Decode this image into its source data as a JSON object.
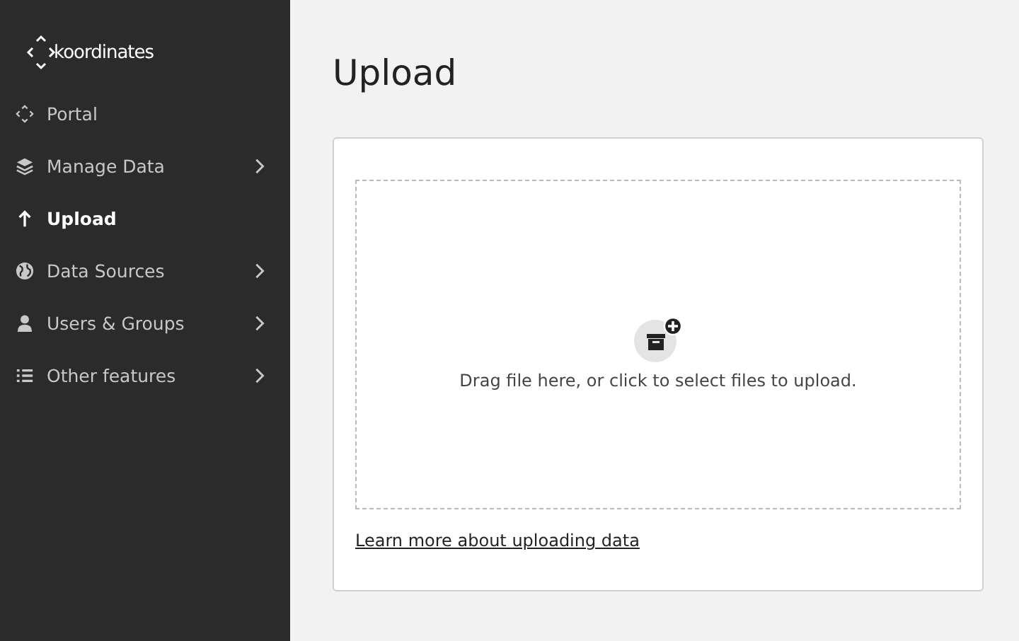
{
  "sidebar": {
    "logo_text": "koordinates",
    "items": [
      {
        "label": "Portal",
        "kind": "portal",
        "selected": false,
        "has_submenu": false
      },
      {
        "label": "Manage Data",
        "kind": "layers",
        "selected": false,
        "has_submenu": true
      },
      {
        "label": "Upload",
        "kind": "upload",
        "selected": true,
        "has_submenu": false
      },
      {
        "label": "Data Sources",
        "kind": "globe",
        "selected": false,
        "has_submenu": true
      },
      {
        "label": "Users & Groups",
        "kind": "user",
        "selected": false,
        "has_submenu": true
      },
      {
        "label": "Other features",
        "kind": "list",
        "selected": false,
        "has_submenu": true
      }
    ]
  },
  "page": {
    "title": "Upload",
    "dropzone_text": "Drag file here, or click to select files to upload.",
    "link": "Learn more about uploading data"
  }
}
